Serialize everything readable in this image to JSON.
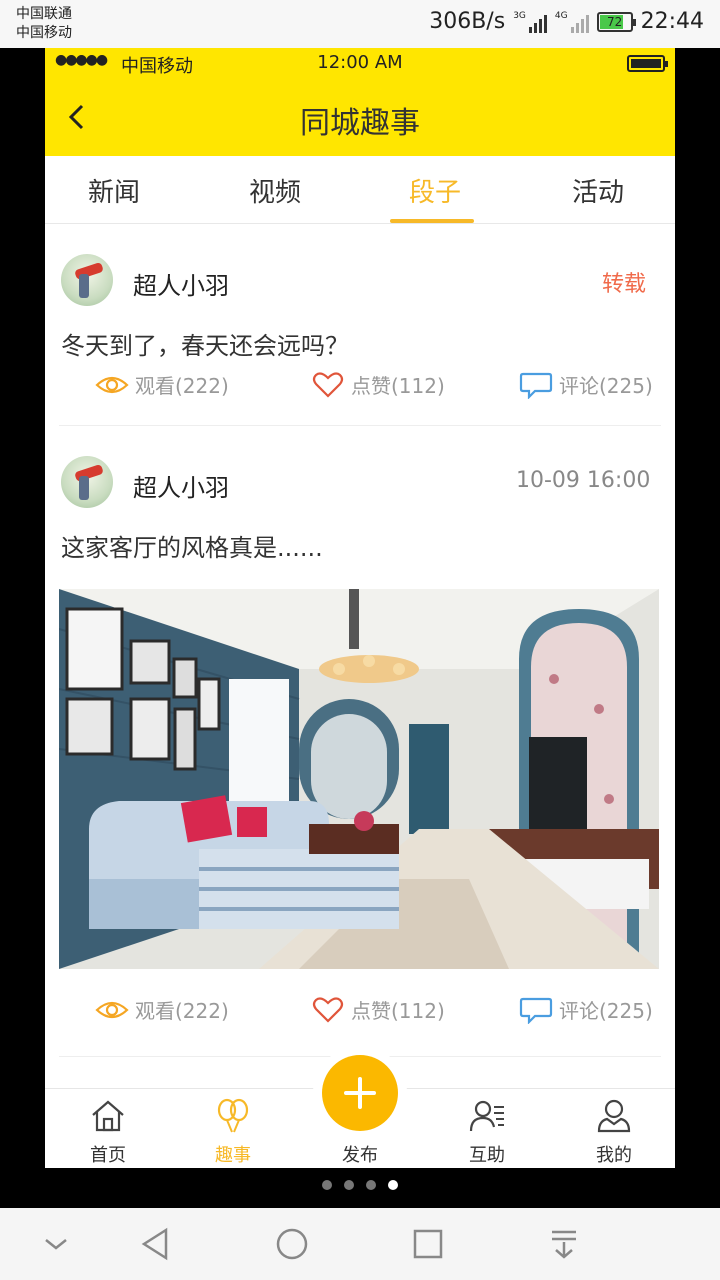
{
  "android_status": {
    "carrier1": "中国联通",
    "carrier2": "中国移动",
    "speed": "306B/s",
    "net1": "3G",
    "net2": "4G",
    "battery": "72",
    "time": "22:44"
  },
  "ios_status": {
    "dots": "●●●●●",
    "carrier": "中国移动",
    "time": "12:00 AM"
  },
  "navbar": {
    "title": "同城趣事",
    "back_icon": "chevron-left-icon"
  },
  "tabs": [
    {
      "label": "新闻",
      "active": false
    },
    {
      "label": "视频",
      "active": false
    },
    {
      "label": "段子",
      "active": true
    },
    {
      "label": "活动",
      "active": false
    }
  ],
  "posts": [
    {
      "user": "超人小羽",
      "tag": "转载",
      "text": "冬天到了，春天还会远吗？",
      "views": "观看(222)",
      "likes": "点赞(112)",
      "comments": "评论(225)"
    },
    {
      "user": "超人小羽",
      "time": "10-09 16:00",
      "text": "这家客厅的风格真是......",
      "image": "living-room-photo",
      "views": "观看(222)",
      "likes": "点赞(112)",
      "comments": "评论(225)"
    }
  ],
  "tabbar": [
    {
      "label": "首页",
      "icon": "home-icon",
      "active": false
    },
    {
      "label": "趣事",
      "icon": "balloons-icon",
      "active": true
    },
    {
      "label": "发布",
      "icon": "plus-icon",
      "active": false
    },
    {
      "label": "互助",
      "icon": "contacts-icon",
      "active": false
    },
    {
      "label": "我的",
      "icon": "user-icon",
      "active": false
    }
  ],
  "colors": {
    "header_yellow": "#ffe600",
    "accent": "#f7b928",
    "repost_red": "#f06a4a",
    "fab": "#fbb800"
  }
}
